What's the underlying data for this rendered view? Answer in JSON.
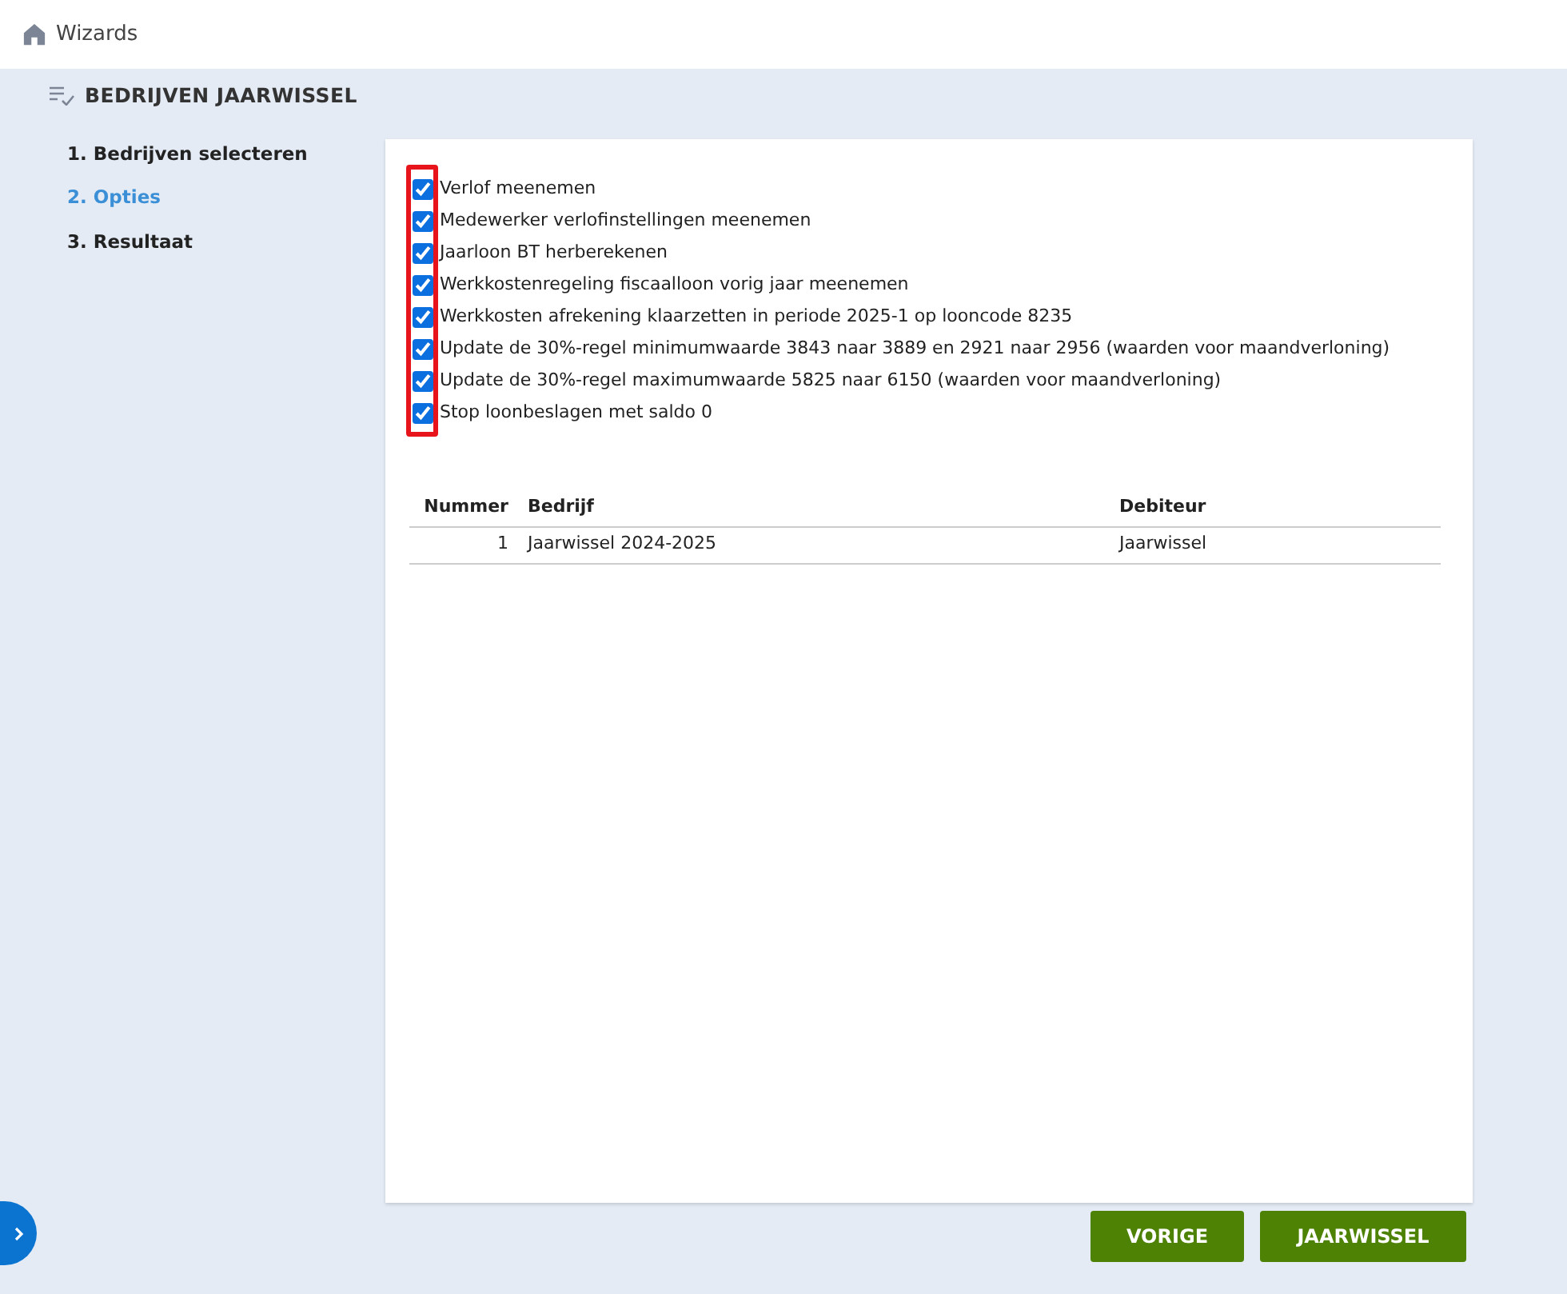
{
  "header": {
    "title": "Wizards"
  },
  "wizard": {
    "title": "BEDRIJVEN JAARWISSEL"
  },
  "steps": [
    {
      "label": "1. Bedrijven selecteren",
      "selected": false
    },
    {
      "label": "2. Opties",
      "selected": true
    },
    {
      "label": "3. Resultaat",
      "selected": false
    }
  ],
  "options_highlighted": true,
  "options": [
    {
      "label": "Verlof meenemen",
      "checked": true
    },
    {
      "label": "Medewerker verlofinstellingen meenemen",
      "checked": true
    },
    {
      "label": "Jaarloon BT herberekenen",
      "checked": true
    },
    {
      "label": "Werkkostenregeling fiscaalloon vorig jaar meenemen",
      "checked": true
    },
    {
      "label": "Werkkosten afrekening klaarzetten in periode 2025-1 op looncode 8235",
      "checked": true
    },
    {
      "label": "Update de 30%-regel minimumwaarde 3843 naar 3889 en 2921 naar 2956 (waarden voor maandverloning)",
      "checked": true
    },
    {
      "label": "Update de 30%-regel maximumwaarde 5825 naar 6150 (waarden voor maandverloning)",
      "checked": true
    },
    {
      "label": "Stop loonbeslagen met saldo 0",
      "checked": true
    }
  ],
  "table": {
    "columns": [
      "Nummer",
      "Bedrijf",
      "Debiteur"
    ],
    "rows": [
      [
        "1",
        "Jaarwissel 2024-2025",
        "Jaarwissel"
      ]
    ]
  },
  "buttons": [
    "VORIGE",
    "JAARWISSEL"
  ]
}
